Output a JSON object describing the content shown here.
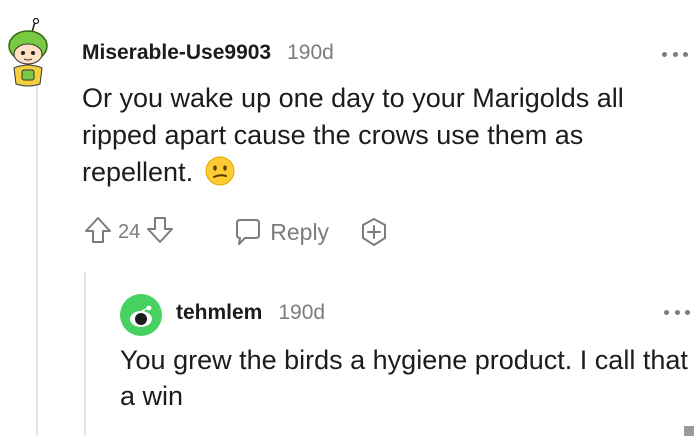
{
  "comment": {
    "username": "Miserable-Use9903",
    "time": "190d",
    "text": "Or you wake up one day to your Marigolds all ripped apart cause the crows use them as repellent.",
    "emoji": "confused-face",
    "upvotes": "24",
    "reply_label": "Reply"
  },
  "reply": {
    "username": "tehmlem",
    "time": "190d",
    "text": "You grew the birds a hygiene product. I call that a win"
  },
  "colors": {
    "meta_text": "#7c7c7c",
    "body_text": "#1c1c1c",
    "thread_line": "#e3e6e8",
    "avatar_green": "#46d160"
  }
}
